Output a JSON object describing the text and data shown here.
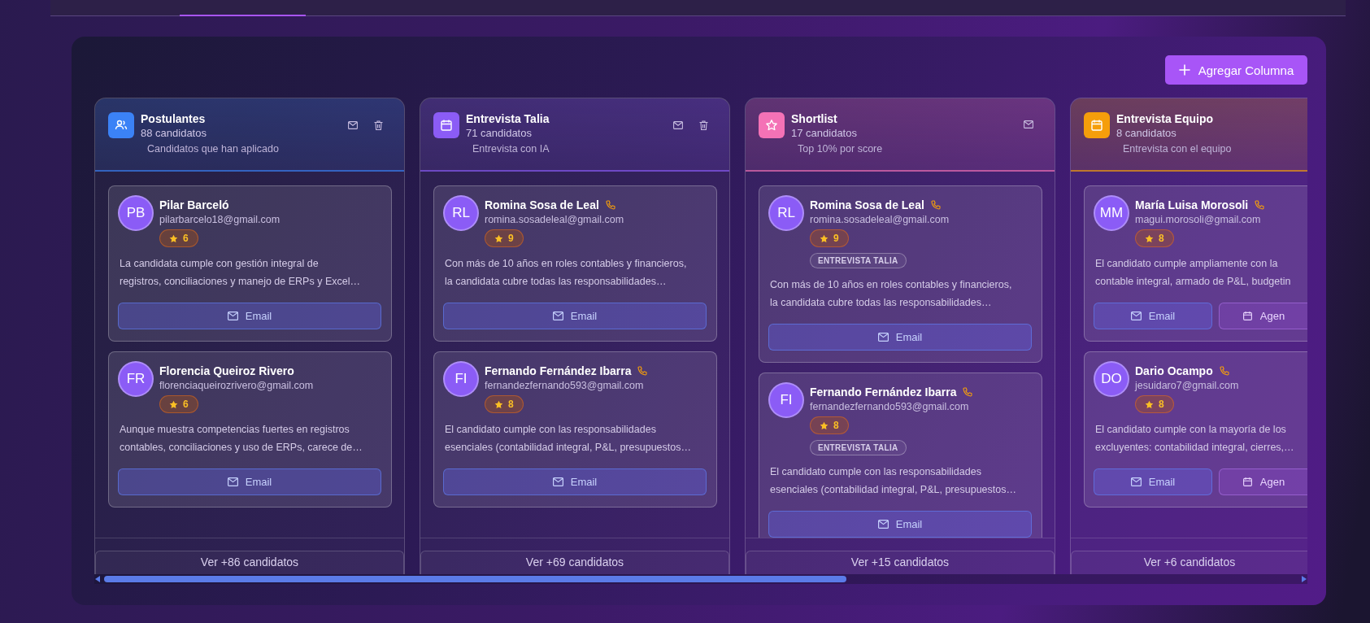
{
  "board": {
    "add_column_button": "Agregar Columna",
    "columns": [
      {
        "title": "Postulantes",
        "count": "88 candidatos",
        "subtitle": "Candidatos que han aplicado",
        "kind": "users",
        "color": "#3b82f6",
        "actions": [
          {
            "kind": "email"
          },
          {
            "kind": "delete"
          }
        ],
        "more": "Ver +86 candidatos",
        "cards": [
          {
            "initials": "PB",
            "name": "Pilar Barceló",
            "phone": false,
            "email": "pilarbarcelo18@gmail.com",
            "score": "6",
            "summary": [
              "La candidata cumple con gestión integral de",
              "registros, conciliaciones y manejo de ERPs y Excel…"
            ],
            "buttons": [
              {
                "kind": "email",
                "label": "Email"
              }
            ]
          },
          {
            "initials": "FR",
            "name": "Florencia Queiroz Rivero",
            "phone": false,
            "email": "florenciaqueirozrivero@gmail.com",
            "score": "6",
            "summary": [
              "Aunque muestra competencias fuertes en registros",
              "contables, conciliaciones y uso de ERPs, carece de…"
            ],
            "buttons": [
              {
                "kind": "email",
                "label": "Email"
              }
            ]
          }
        ]
      },
      {
        "title": "Entrevista Talia",
        "count": "71 candidatos",
        "subtitle": "Entrevista con IA",
        "kind": "calendar",
        "color": "#8b5cf6",
        "actions": [
          {
            "kind": "email"
          },
          {
            "kind": "delete"
          }
        ],
        "more": "Ver +69 candidatos",
        "cards": [
          {
            "initials": "RL",
            "name": "Romina Sosa de Leal",
            "phone": true,
            "email": "romina.sosadeleal@gmail.com",
            "score": "9",
            "summary": [
              "Con más de 10 años en roles contables y financieros,",
              "la candidata cubre todas las responsabilidades…"
            ],
            "buttons": [
              {
                "kind": "email",
                "label": "Email"
              }
            ]
          },
          {
            "initials": "FI",
            "name": "Fernando Fernández Ibarra",
            "phone": true,
            "email": "fernandezfernando593@gmail.com",
            "score": "8",
            "summary": [
              "El candidato cumple con las responsabilidades",
              "esenciales (contabilidad integral, P&L, presupuestos…"
            ],
            "buttons": [
              {
                "kind": "email",
                "label": "Email"
              }
            ]
          }
        ]
      },
      {
        "title": "Shortlist",
        "count": "17 candidatos",
        "subtitle": "Top 10% por score",
        "kind": "star",
        "color": "#f472b6",
        "actions": [
          {
            "kind": "email"
          }
        ],
        "more": "Ver +15 candidatos",
        "cards": [
          {
            "initials": "RL",
            "name": "Romina Sosa de Leal",
            "phone": true,
            "email": "romina.sosadeleal@gmail.com",
            "score": "9",
            "tag": "ENTREVISTA TALIA",
            "summary": [
              "Con más de 10 años en roles contables y financieros,",
              "la candidata cubre todas las responsabilidades…"
            ],
            "buttons": [
              {
                "kind": "email",
                "label": "Email"
              }
            ]
          },
          {
            "initials": "FI",
            "name": "Fernando Fernández Ibarra",
            "phone": true,
            "email": "fernandezfernando593@gmail.com",
            "score": "8",
            "tag": "ENTREVISTA TALIA",
            "summary": [
              "El candidato cumple con las responsabilidades",
              "esenciales (contabilidad integral, P&L, presupuestos…"
            ],
            "buttons": [
              {
                "kind": "email",
                "label": "Email"
              }
            ]
          }
        ]
      },
      {
        "title": "Entrevista Equipo",
        "count": "8 candidatos",
        "subtitle": "Entrevista con el equipo",
        "kind": "calendar",
        "color": "#f59e0b",
        "more": "Ver +6 candidatos",
        "cards": [
          {
            "initials": "MM",
            "name": "María Luisa Morosoli",
            "phone": true,
            "email": "magui.morosoli@gmail.com",
            "score": "8",
            "summary": [
              "El candidato cumple ampliamente con la",
              "contable integral, armado de P&L, budgetin"
            ],
            "buttons": [
              {
                "kind": "email",
                "label": "Email"
              },
              {
                "kind": "schedule",
                "label": "Agen"
              }
            ]
          },
          {
            "initials": "DO",
            "name": "Dario Ocampo",
            "phone": true,
            "email": "jesuidaro7@gmail.com",
            "score": "8",
            "summary": [
              "El candidato cumple con la mayoría de los",
              "excluyentes: contabilidad integral, cierres,…"
            ],
            "buttons": [
              {
                "kind": "email",
                "label": "Email"
              },
              {
                "kind": "schedule",
                "label": "Agen"
              }
            ]
          }
        ]
      }
    ]
  }
}
